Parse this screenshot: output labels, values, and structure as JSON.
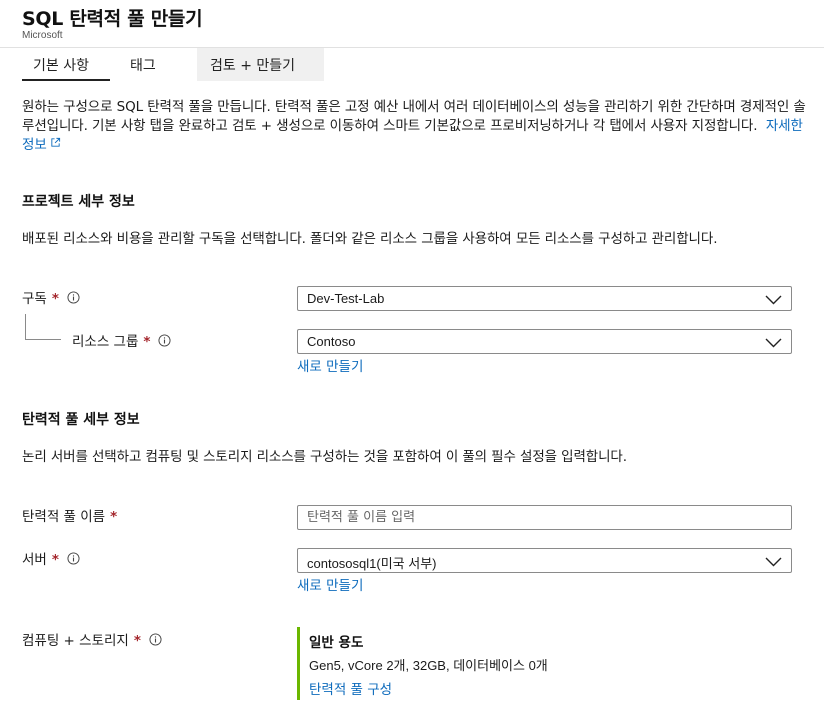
{
  "header": {
    "title": "SQL 탄력적 풀 만들기",
    "publisher": "Microsoft"
  },
  "tabs": [
    {
      "label": "기본 사항",
      "active": true
    },
    {
      "label": "태그",
      "active": false
    },
    {
      "label": "검토 + 만들기",
      "active": false
    }
  ],
  "intro": {
    "text": "원하는 구성으로 SQL 탄력적 풀을 만듭니다. 탄력적 풀은 고정 예산 내에서 여러 데이터베이스의 성능을 관리하기 위한 간단하며 경제적인 솔루션입니다. 기본 사항 탭을 완료하고 검토 + 생성으로 이동하여 스마트 기본값으로 프로비저닝하거나 각 탭에서 사용자 지정합니다.",
    "learn_more": "자세한 정보"
  },
  "project": {
    "heading": "프로젝트 세부 정보",
    "description": "배포된 리소스와 비용을 관리할 구독을 선택합니다. 폴더와 같은 리소스 그룹을 사용하여 모든 리소스를 구성하고 관리합니다.",
    "subscription_label": "구독",
    "subscription_value": "Dev-Test-Lab",
    "resource_group_label": "리소스 그룹",
    "resource_group_value": "Contoso",
    "create_new": "새로 만들기"
  },
  "pool": {
    "heading": "탄력적 풀 세부 정보",
    "description": "논리 서버를 선택하고 컴퓨팅 및 스토리지 리소스를 구성하는 것을 포함하여 이 풀의 필수 설정을 입력합니다.",
    "name_label": "탄력적 풀 이름",
    "name_placeholder": "탄력적 풀 이름 입력",
    "server_label": "서버",
    "server_value": "contososql1(미국 서부)",
    "create_new": "새로 만들기",
    "compute_label": "컴퓨팅 + 스토리지",
    "compute_tier": "일반 용도",
    "compute_detail": "Gen5, vCore 2개, 32GB, 데이터베이스 0개",
    "configure_link": "탄력적 풀 구성"
  },
  "required_marker": "*",
  "colors": {
    "accent_link": "#0f6cbd",
    "required": "#a4262c",
    "compute_bar": "#6bb700"
  }
}
